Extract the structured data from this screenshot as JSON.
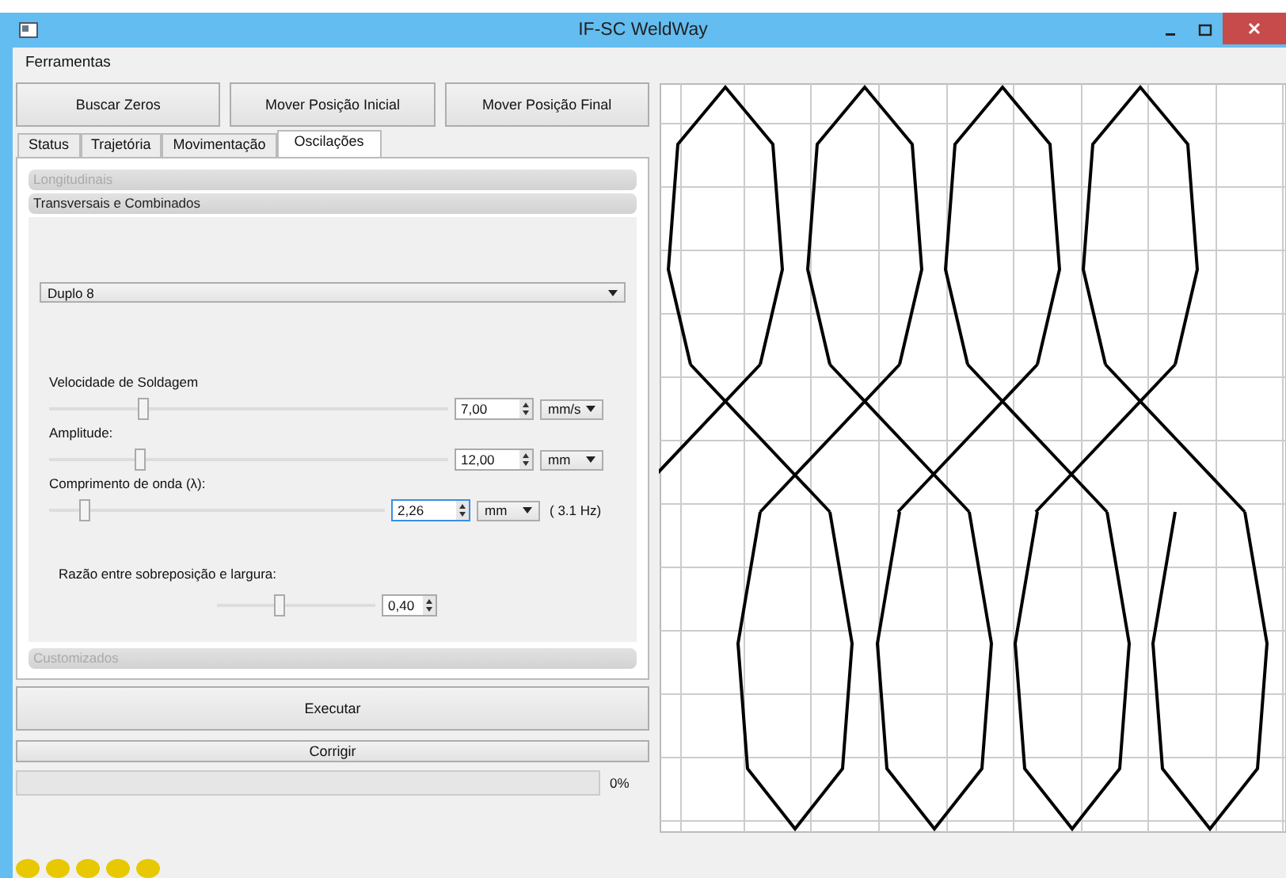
{
  "window": {
    "title": "IF-SC WeldWay"
  },
  "menu": [
    "Ferramentas"
  ],
  "top_buttons": [
    "Buscar Zeros",
    "Mover Posição Inicial",
    "Mover Posição Final"
  ],
  "tabs": [
    {
      "label": "Status",
      "selected": false
    },
    {
      "label": "Trajetória",
      "selected": false
    },
    {
      "label": "Movimentação",
      "selected": false
    },
    {
      "label": "Oscilações",
      "selected": true
    }
  ],
  "sections": [
    {
      "label": "Longitudinais",
      "disabled": true
    },
    {
      "label": "Transversais e Combinados",
      "disabled": false,
      "pattern": {
        "value": "Duplo 8"
      },
      "parameters": [
        {
          "label": "Velocidade de Soldagem",
          "level": 0.24,
          "value": "7,00",
          "unit": "mm/s",
          "focused": false
        },
        {
          "label": "Amplitude:",
          "level": 0.23,
          "value": "12,00",
          "unit": "mm",
          "focused": false
        },
        {
          "label": "Comprimento de onda (λ):",
          "level": 0.11,
          "value": "2,26",
          "unit": "mm",
          "focused": true,
          "note": "( 3.1 Hz)"
        }
      ],
      "ratio": {
        "label": "Razão entre sobreposição e largura:",
        "level": 0.4,
        "value": "0,40"
      }
    },
    {
      "label": "Customizados",
      "disabled": true
    }
  ],
  "buttons": [
    "Executar",
    "Corrigir"
  ],
  "progress": {
    "level": 0,
    "reading": "0%"
  },
  "status_lights": [
    {
      "color": "#e8c800"
    },
    {
      "color": "#e8c800"
    },
    {
      "color": "#e8c800"
    },
    {
      "color": "#e8c800"
    },
    {
      "color": "#e8c800"
    }
  ]
}
